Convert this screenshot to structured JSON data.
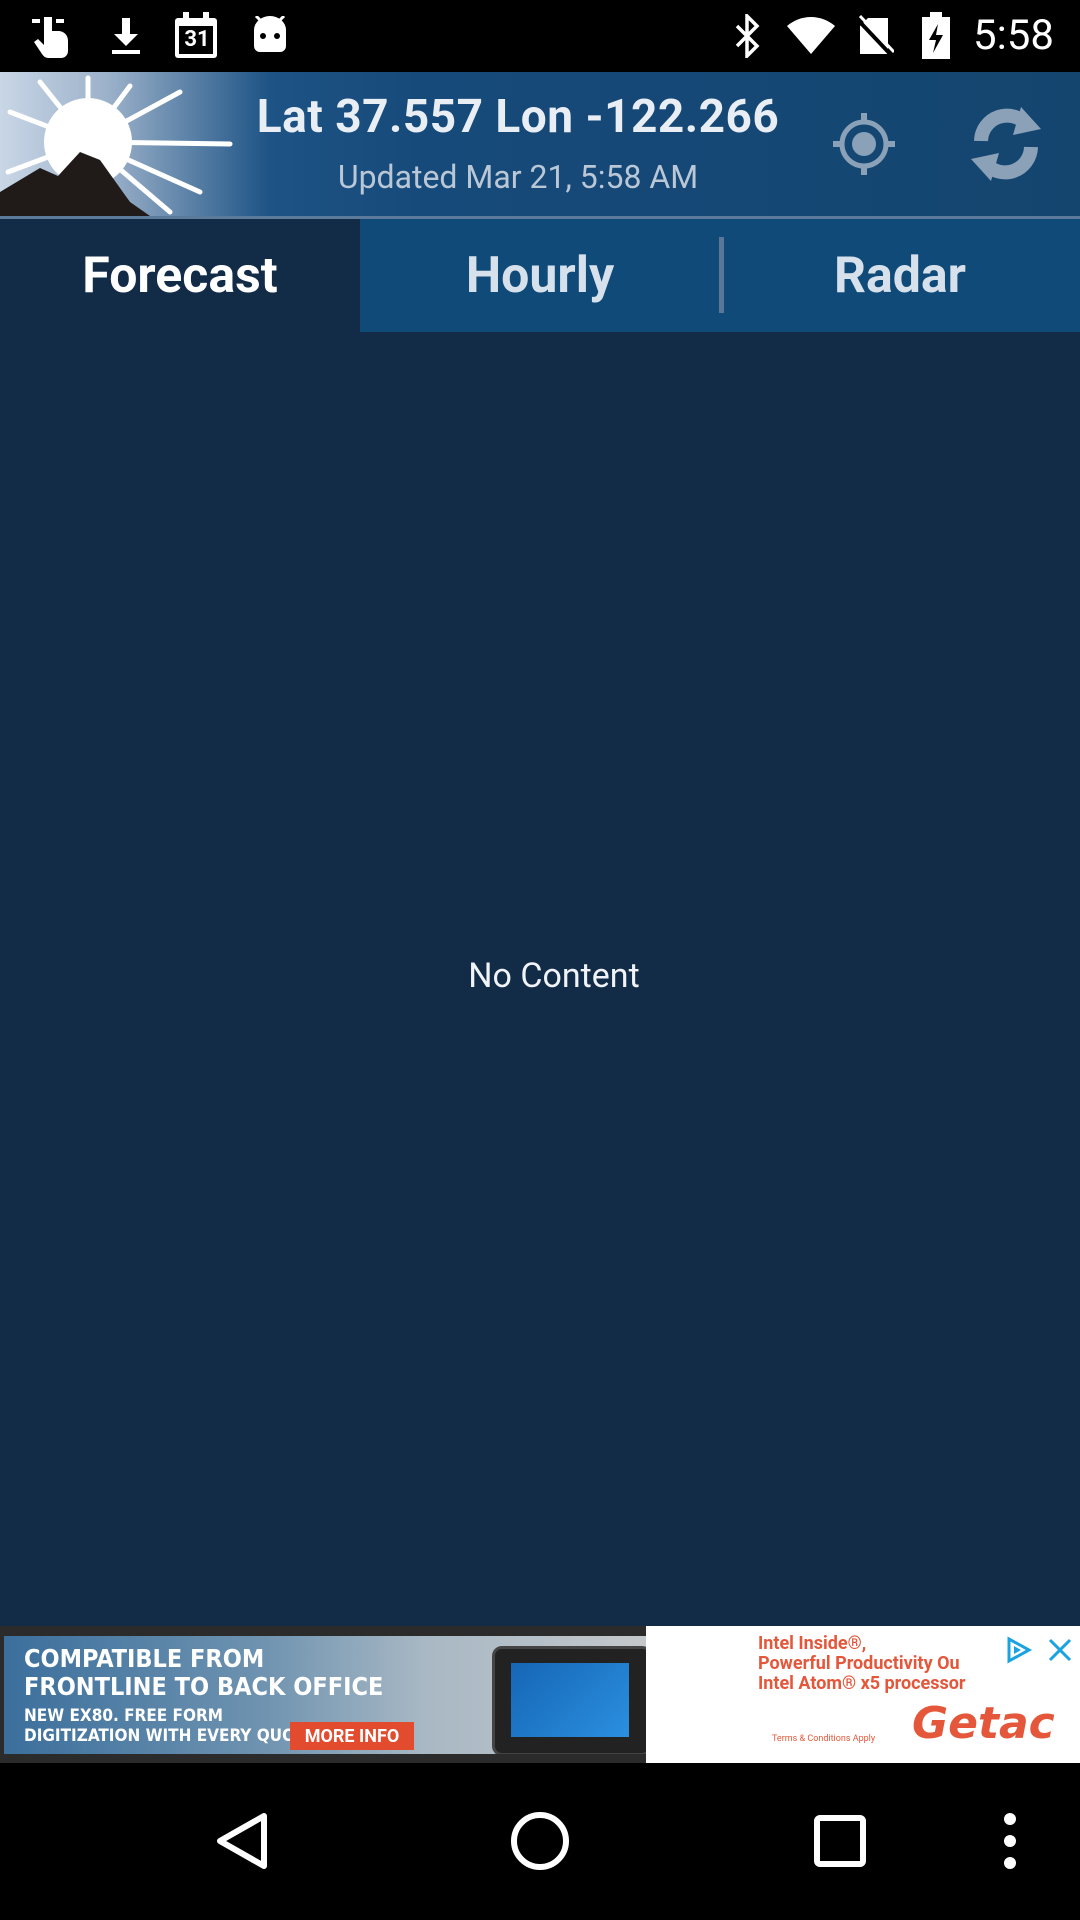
{
  "status_bar": {
    "time": "5:58",
    "calendar_day": "31",
    "left_icons": [
      "touch-icon",
      "download-icon",
      "calendar-icon",
      "android-icon"
    ],
    "right_icons": [
      "bluetooth-icon",
      "wifi-icon",
      "no-sim-icon",
      "battery-charging-icon"
    ]
  },
  "header": {
    "location_title": "Lat 37.557 Lon -122.266",
    "updated_text": "Updated Mar 21, 5:58 AM",
    "icons": [
      "app-logo-sun-mountain-icon",
      "my-location-icon",
      "refresh-icon"
    ]
  },
  "tabs": [
    {
      "label": "Forecast",
      "active": true
    },
    {
      "label": "Hourly",
      "active": false
    },
    {
      "label": "Radar",
      "active": false
    }
  ],
  "content": {
    "empty_message": "No Content"
  },
  "ad": {
    "headline_line1": "COMPATIBLE FROM",
    "headline_line2": "FRONTLINE TO BACK OFFICE",
    "sub_line1": "NEW EX80. FREE FORM",
    "sub_line2": "DIGITIZATION WITH EVERY QUOTE",
    "cta_label": "MORE INFO",
    "intel_line1": "Intel Inside®,",
    "intel_line2": "Powerful Productivity Ou",
    "intel_line3": "Intel Atom® x5 processor",
    "terms": "Terms & Conditions Apply",
    "brand": "Getac",
    "icons": [
      "adchoices-icon",
      "close-icon"
    ]
  },
  "nav_bar": {
    "icons": [
      "back-icon",
      "home-icon",
      "recents-icon",
      "more-icon"
    ]
  },
  "colors": {
    "background": "#122b47",
    "tab_bar": "#0f4a78",
    "ad_accent": "#e5573a"
  }
}
